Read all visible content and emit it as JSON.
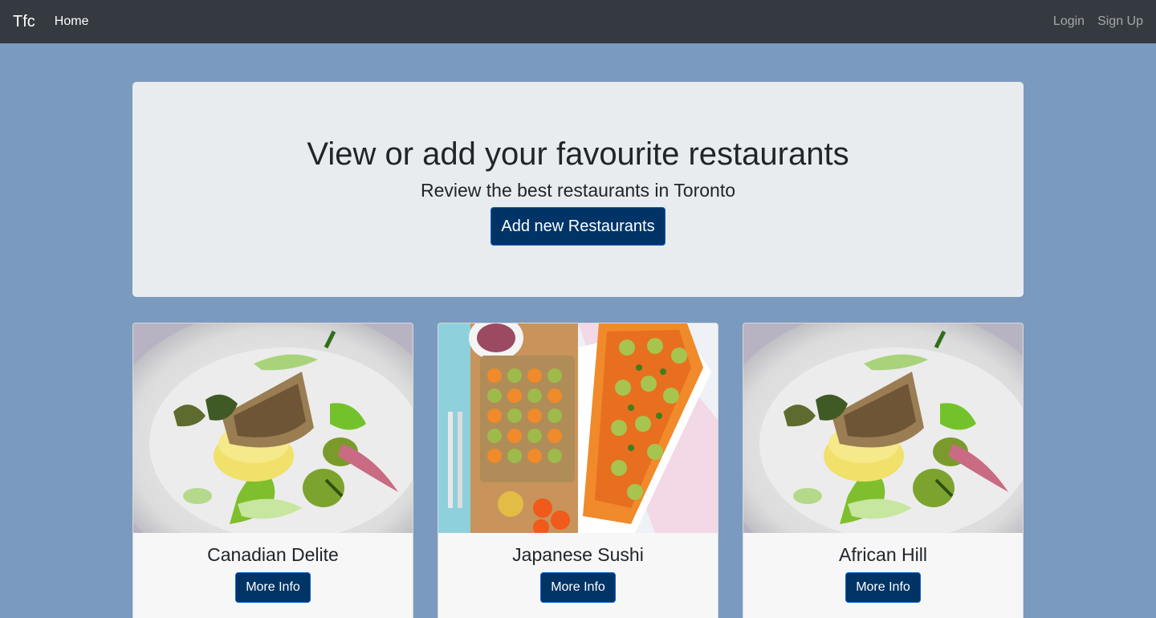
{
  "navbar": {
    "brand": "Tfc",
    "home": "Home",
    "login": "Login",
    "signup": "Sign Up"
  },
  "hero": {
    "title": "View or add your favourite restaurants",
    "subtitle": "Review the best restaurants in Toronto",
    "add_button": "Add new Restaurants"
  },
  "cards": [
    {
      "name": "Canadian Delite",
      "button": "More Info",
      "image": "plated-fish-dish-photo"
    },
    {
      "name": "Japanese Sushi",
      "button": "More Info",
      "image": "vegetable-tart-photo"
    },
    {
      "name": "African Hill",
      "button": "More Info",
      "image": "plated-fish-dish-photo"
    }
  ],
  "colors": {
    "page_bg": "#7b9abf",
    "navbar_bg": "#343a40",
    "jumbotron_bg": "#e9ecef",
    "button_bg": "#003466",
    "card_bg": "#f7f7f7"
  }
}
